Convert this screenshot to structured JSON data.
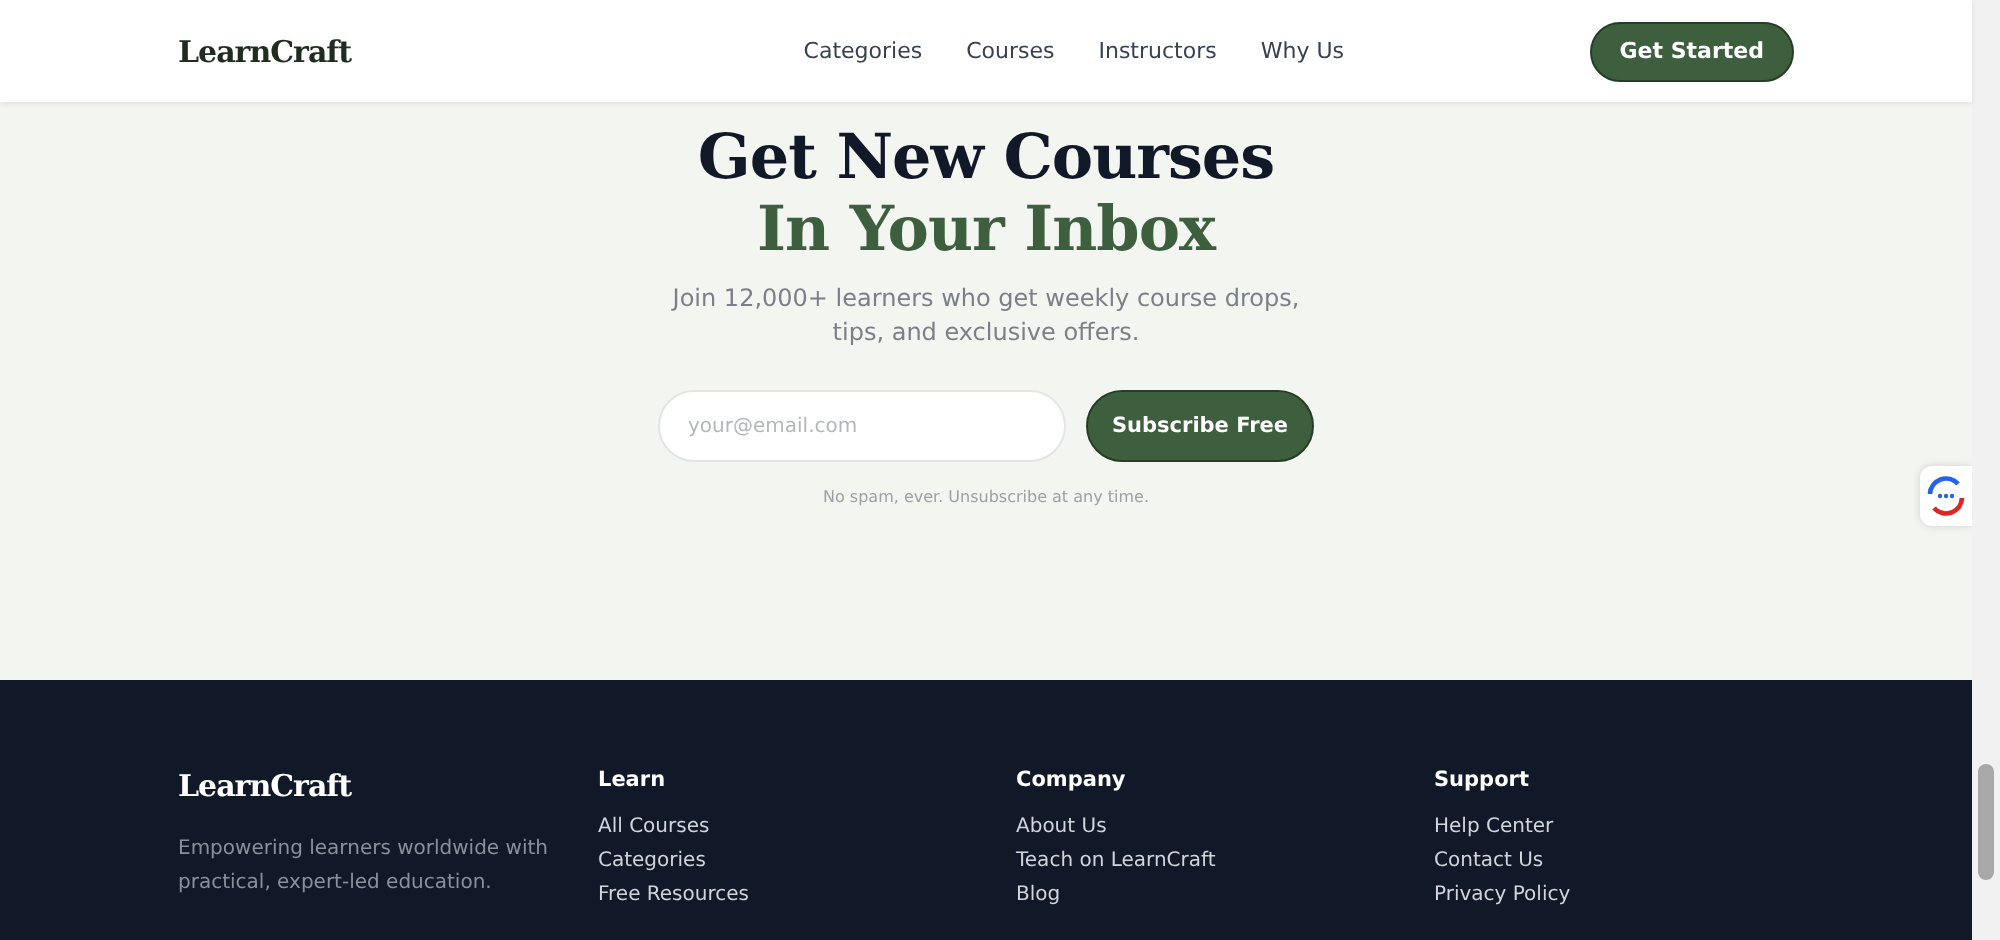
{
  "header": {
    "logo": "LearnCraft",
    "nav": [
      "Categories",
      "Courses",
      "Instructors",
      "Why Us"
    ],
    "cta": "Get Started"
  },
  "hero": {
    "title": "Get New Courses",
    "title_accent": "In Your Inbox",
    "subtitle": "Join 12,000+ learners who get weekly course drops, tips, and exclusive offers.",
    "email": {
      "placeholder": "your@email.com"
    },
    "button": "Subscribe Free",
    "note": "No spam, ever. Unsubscribe at any time."
  },
  "footer": {
    "logo": "LearnCraft",
    "tagline": "Empowering learners worldwide with practical, expert-led education.",
    "columns": [
      {
        "heading": "Learn",
        "links": [
          "All Courses",
          "Categories",
          "Free Resources"
        ]
      },
      {
        "heading": "Company",
        "links": [
          "About Us",
          "Teach on LearnCraft",
          "Blog"
        ]
      },
      {
        "heading": "Support",
        "links": [
          "Help Center",
          "Contact Us",
          "Privacy Policy"
        ]
      }
    ]
  }
}
